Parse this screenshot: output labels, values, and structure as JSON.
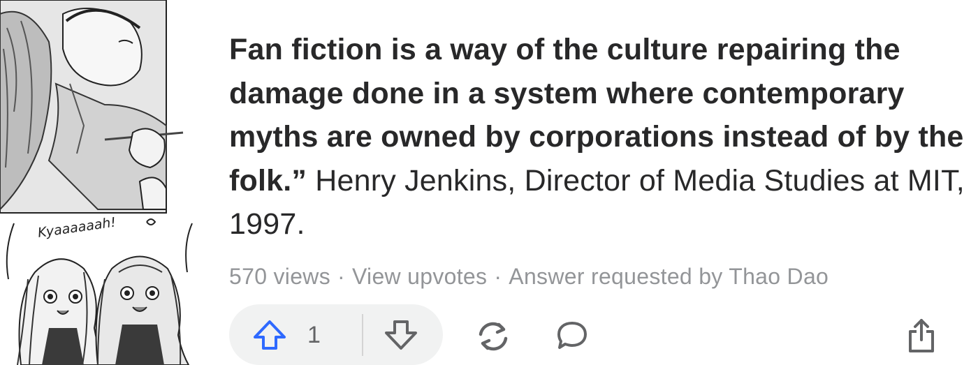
{
  "illustration": {
    "sfx_text": "Kyaaaaaah!"
  },
  "answer": {
    "quote_bold": "Fan fiction is a way of the culture repairing the damage done in a system where contemporary myths are owned by corporations instead of by the folk.”",
    "attribution": "Henry Jenkins, Director of Media Studies at MIT, 1997."
  },
  "meta": {
    "views": "570 views",
    "sep1": "·",
    "view_upvotes": "View upvotes",
    "sep2": "·",
    "requested_by": "Answer requested by Thao Dao"
  },
  "actions": {
    "upvote_count": "1",
    "upvote_color": "#2e69ff",
    "icon_color": "#636466",
    "icons": [
      "arrow-up-icon",
      "arrow-down-icon",
      "share-cycle-icon",
      "comment-icon",
      "upload-icon"
    ]
  }
}
